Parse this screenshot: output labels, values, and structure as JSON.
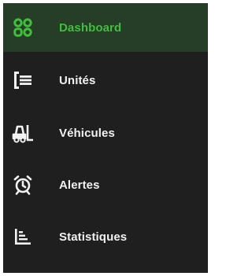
{
  "colors": {
    "sidebar_background": "#1f1f1f",
    "active_background": "#263d27",
    "active_accent": "#3fbf3a",
    "text": "#f2f2f2"
  },
  "sidebar": {
    "items": [
      {
        "label": "Dashboard",
        "icon": "dashboard-grid-icon",
        "active": true
      },
      {
        "label": "Unités",
        "icon": "list-icon",
        "active": false
      },
      {
        "label": "Véhicules",
        "icon": "forklift-icon",
        "active": false
      },
      {
        "label": "Alertes",
        "icon": "alarm-clock-icon",
        "active": false
      },
      {
        "label": "Statistiques",
        "icon": "bar-chart-icon",
        "active": false
      }
    ]
  }
}
